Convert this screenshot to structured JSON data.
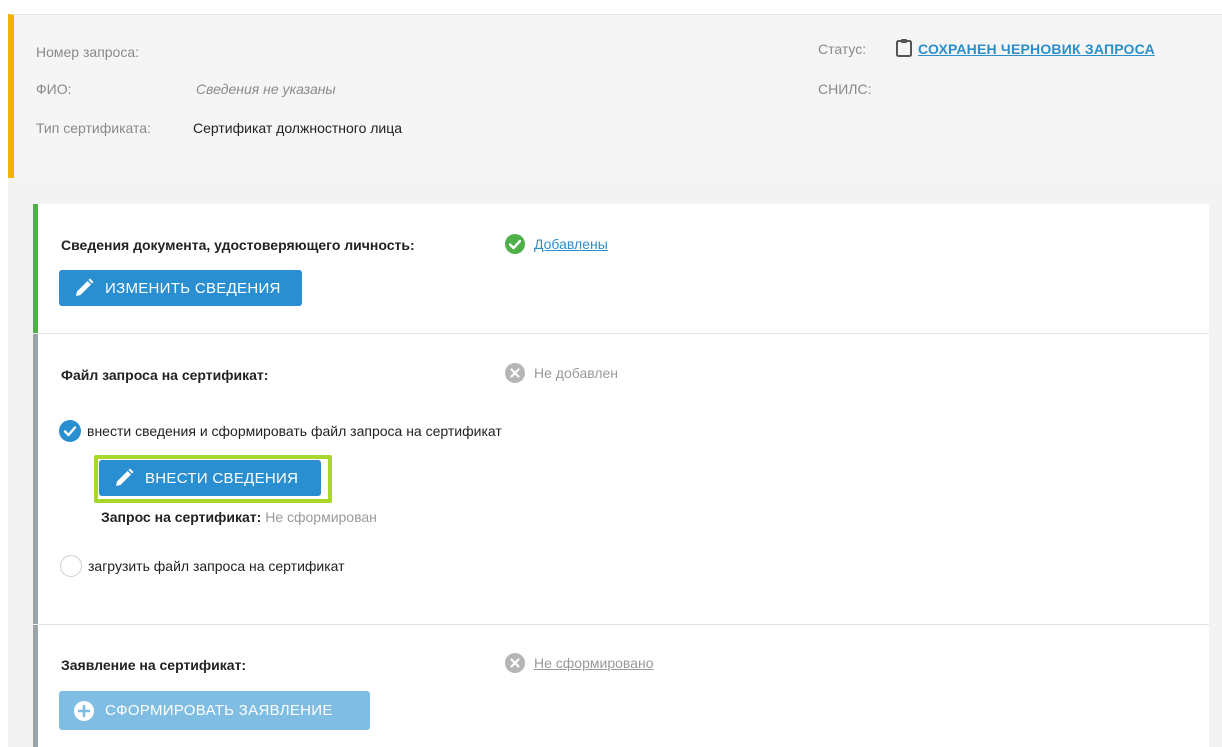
{
  "header": {
    "request_number_label": "Номер запроса:",
    "request_number_value": "",
    "fio_label": "ФИО:",
    "fio_value": "Сведения не указаны",
    "cert_type_label": "Тип сертификата:",
    "cert_type_value": "Сертификат должностного лица",
    "status_label": "Статус:",
    "status_value": "СОХРАНЕН ЧЕРНОВИК ЗАПРОСА",
    "snils_label": "СНИЛС:",
    "snils_value": ""
  },
  "sections": {
    "identity": {
      "title": "Сведения документа, удостоверяющего личность:",
      "state": "Добавлены",
      "button": "ИЗМЕНИТЬ СВЕДЕНИЯ"
    },
    "request_file": {
      "title": "Файл запроса на сертификат:",
      "state": "Не добавлен",
      "option_generate": "внести сведения и сформировать файл запроса на сертификат",
      "button": "ВНЕСТИ СВЕДЕНИЯ",
      "request_label": "Запрос на сертификат:",
      "request_value": "Не сформирован",
      "option_upload": "загрузить файл запроса на сертификат"
    },
    "application": {
      "title": "Заявление на сертификат:",
      "state": "Не сформировано",
      "button": "СФОРМИРОВАТЬ ЗАЯВЛЕНИЕ"
    }
  },
  "colors": {
    "accent_yellow": "#f0b400",
    "accent_green": "#4fb04a",
    "primary_blue": "#2a8fd0",
    "highlight_green": "#a8d62a"
  }
}
